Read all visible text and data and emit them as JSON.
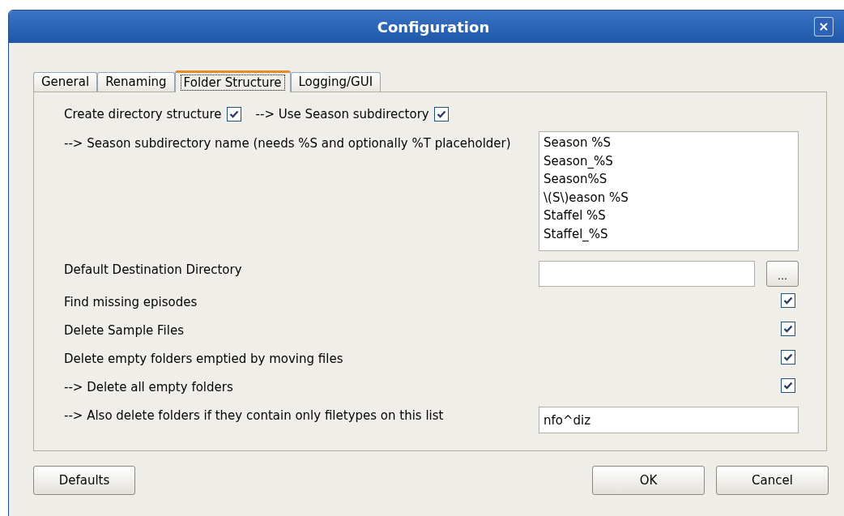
{
  "window": {
    "title": "Configuration",
    "close": "×"
  },
  "tabs": [
    {
      "label": "General",
      "selected": false
    },
    {
      "label": "Renaming",
      "selected": false
    },
    {
      "label": "Folder Structure",
      "selected": true
    },
    {
      "label": "Logging/GUI",
      "selected": false
    }
  ],
  "top_row": [
    {
      "label": "Create directory structure",
      "checked": true
    },
    {
      "label": "--> Use Season subdirectory",
      "checked": true
    }
  ],
  "rows": [
    {
      "kind": "list",
      "label": "--> Season subdirectory name (needs %S and optionally %T placeholder)",
      "items": [
        "Season %S",
        "Season_%S",
        "Season%S",
        "\\(S\\)eason %S",
        "Staffel %S",
        "Staffel_%S"
      ]
    },
    {
      "kind": "browse",
      "label": "Default Destination Directory",
      "button": "..."
    },
    {
      "kind": "check",
      "label": "Find missing episodes",
      "checked": true
    },
    {
      "kind": "check",
      "label": "Delete Sample Files",
      "checked": true
    },
    {
      "kind": "check",
      "label": "Delete empty folders emptied by moving files",
      "checked": true
    },
    {
      "kind": "check",
      "label": "--> Delete all empty folders",
      "checked": true
    },
    {
      "kind": "text",
      "label": "--> Also delete folders if they contain only filetypes on this list",
      "value": "nfo^diz"
    }
  ],
  "buttons": {
    "left": [
      "Defaults"
    ],
    "right": [
      "OK",
      "Cancel"
    ]
  }
}
